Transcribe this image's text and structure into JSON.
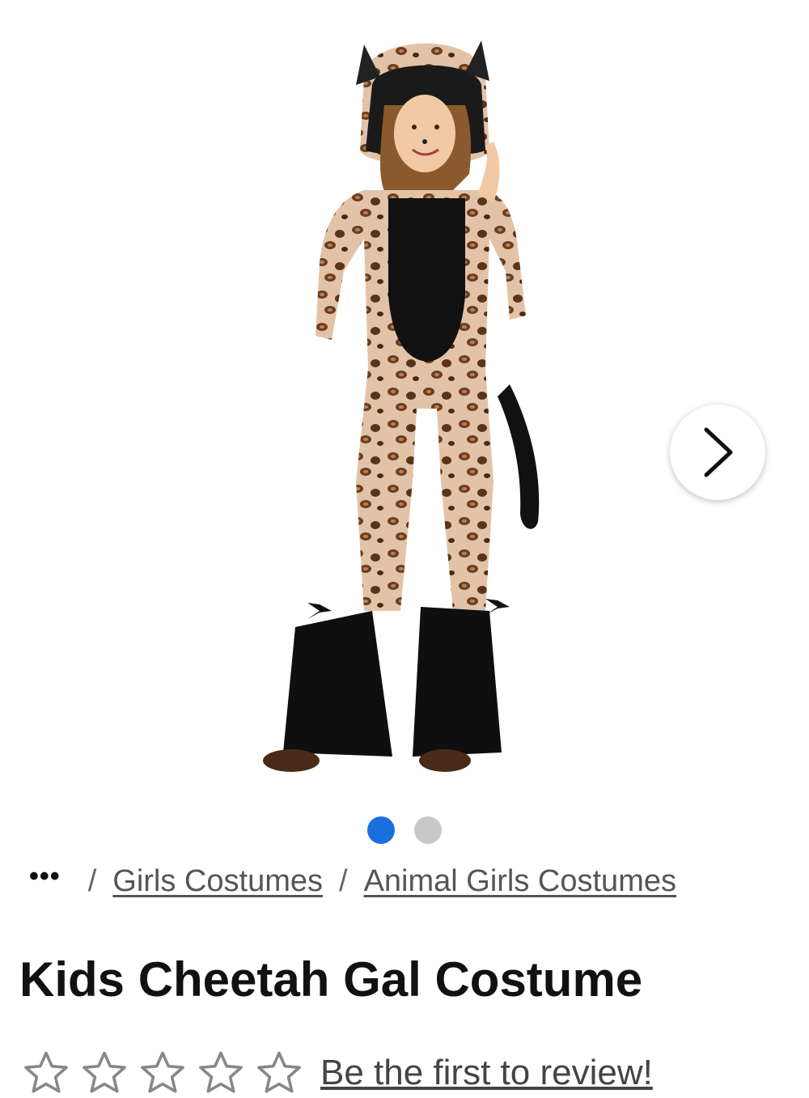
{
  "product": {
    "title": "Kids Cheetah Gal Costume",
    "image_icon": "product-photo-cheetah-costume"
  },
  "gallery": {
    "dot_count": 2,
    "active_index": 0,
    "next_icon": "chevron-right-icon",
    "active_color": "#1a6fe0",
    "inactive_color": "#c8c8c8"
  },
  "breadcrumb": {
    "ellipsis": "•••",
    "separator": "/",
    "items": [
      {
        "label": "Girls Costumes"
      },
      {
        "label": "Animal Girls Costumes"
      }
    ]
  },
  "rating": {
    "stars_filled": 0,
    "stars_total": 5,
    "review_prompt": "Be the first to review!"
  }
}
